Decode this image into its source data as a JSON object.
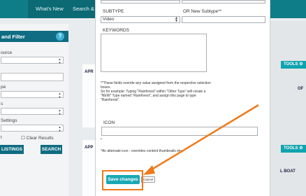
{
  "header": {
    "nav_whats_new": "What's New",
    "nav_search": "Search &"
  },
  "left_panel": {
    "title": "and Filter",
    "help_icon": "?",
    "label_source": "ource",
    "label_pe": "pe",
    "label_s": "s",
    "label_settings": "Settings",
    "clear_results": "Clear Results",
    "listings_button": "LISTINGS",
    "search_button": "SEARCH",
    "t_label": "t"
  },
  "right_panel": {
    "tools_label": "TOOLS",
    "card_text_1": "APR",
    "card_text_2": "APP",
    "card_text_3": "OF",
    "card_text_4": "L BOAT"
  },
  "modal": {
    "subtype_label": "SUBTYPE",
    "subtype_value": "Video",
    "new_subtype_label": "OR New Subtype**",
    "keywords_label": "KEYWORDS",
    "note_lines": [
      "**These fields overide any value assigned from the respective selection",
      "boxes.",
      "So for example: Typing \"Rainforest\" within \"Other Type\" will create a",
      "\"NEW\" Type named \"Rainforest\", and assign this page to type",
      "\"Rainforest\"."
    ],
    "icon_label": "ICON",
    "icon_note": "*An alternate icon - overrides content thumbnails etc..",
    "save_label": "Save changes",
    "cancel_label": "Cancel"
  },
  "colors": {
    "accent": "#1aa9b4",
    "highlight": "#f07a1a",
    "header": "#0f7d88"
  }
}
